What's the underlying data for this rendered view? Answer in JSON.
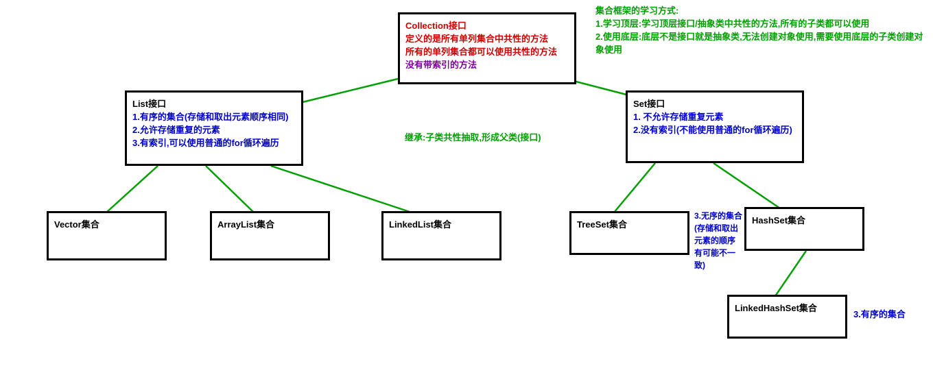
{
  "tips": {
    "l1": "集合框架的学习方式:",
    "l2": "1.学习顶层:学习顶层接口/抽象类中共性的方法,所有的子类都可以使用",
    "l3": "2.使用底层:底层不是接口就是抽象类,无法创建对象使用,需要使用底层的子类创建对象使用"
  },
  "collection": {
    "title": "Collection接口",
    "l1": "定义的是所有单列集合中共性的方法",
    "l2": "所有的单列集合都可以使用共性的方法",
    "l3": "没有带索引的方法"
  },
  "inherit": "继承:子类共性抽取,形成父类(接口)",
  "list": {
    "title": "List接口",
    "l1": "1.有序的集合(存储和取出元素顺序相同)",
    "l2": "2.允许存储重复的元素",
    "l3": "3.有索引,可以使用普通的for循环遍历"
  },
  "set": {
    "title": "Set接口",
    "l1": "1. 不允许存储重复元素",
    "l2": "2.没有索引(不能使用普通的for循环遍历)"
  },
  "vector": {
    "title": "Vector集合"
  },
  "arraylist": {
    "title": "ArrayList集合"
  },
  "linkedlist": {
    "title": "LinkedList集合"
  },
  "treeset": {
    "title": "TreeSet集合"
  },
  "hashset": {
    "title": "HashSet集合"
  },
  "linkedhashset": {
    "title": "LinkedHashSet集合"
  },
  "hashset_note": "3.无序的集合(存储和取出元素的顺序有可能不一致)",
  "linkedhashset_note": "3.有序的集合"
}
